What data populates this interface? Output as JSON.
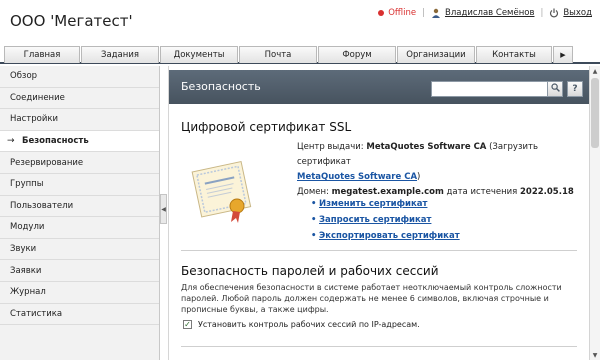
{
  "company": "ООО 'Мегатест'",
  "userbar": {
    "status": "Offline",
    "user_name": "Владислав Семёнов",
    "logout": "Выход"
  },
  "tabs": [
    "Главная",
    "Задания",
    "Документы",
    "Почта",
    "Форум",
    "Организации",
    "Контакты"
  ],
  "tabs_more_icon": "chevron-right-icon",
  "sidebar": {
    "items": [
      {
        "label": "Обзор"
      },
      {
        "label": "Соединение"
      },
      {
        "label": "Настройки"
      },
      {
        "label": "Безопасность",
        "active": true
      },
      {
        "label": "Резервирование"
      },
      {
        "label": "Группы"
      },
      {
        "label": "Пользователи"
      },
      {
        "label": "Модули"
      },
      {
        "label": "Звуки"
      },
      {
        "label": "Заявки"
      },
      {
        "label": "Журнал"
      },
      {
        "label": "Статистика"
      }
    ]
  },
  "main": {
    "banner_title": "Безопасность",
    "search_value": "",
    "help_label": "?",
    "ssl_title": "Цифровой сертификат SSL",
    "issuer_label": "Центр выдачи:",
    "issuer_value": "MetaQuotes Software CA",
    "download_prefix": "(Загрузить сертификат",
    "download_link": "MetaQuotes Software CA",
    "download_suffix": ")",
    "domain_label": "Домен:",
    "domain_value": "megatest.example.com",
    "expiry_label": "дата истечения",
    "expiry_value": "2022.05.18",
    "actions": [
      "Изменить сертификат",
      "Запросить сертификат",
      "Экспортировать сертификат"
    ],
    "password_title": "Безопасность паролей и рабочих сессий",
    "password_desc": "Для обеспечения безопасности в системе работает неотключаемый контроль сложности паролей. Любой пароль должен содержать не менее 6 символов, включая строчные и прописные буквы, а также цифры.",
    "session_checkbox_label": "Установить контроль рабочих сессий по IP-адресам.",
    "session_checkbox_checked": true
  },
  "colors": {
    "banner": "#4f5c69",
    "link": "#1a55a3",
    "offline": "#d93030"
  }
}
